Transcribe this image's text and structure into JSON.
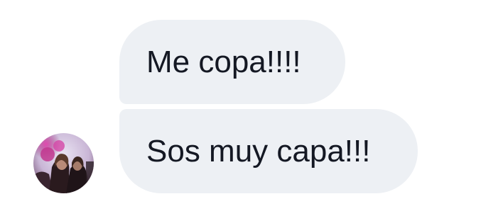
{
  "messages": [
    {
      "text": "Me copa!!!!"
    },
    {
      "text": "Sos muy capa!!!"
    }
  ],
  "sender": {
    "avatar_icon": "user-avatar-photo"
  },
  "colors": {
    "bubble_background": "#edf0f4",
    "text": "#141823",
    "background": "#ffffff"
  }
}
